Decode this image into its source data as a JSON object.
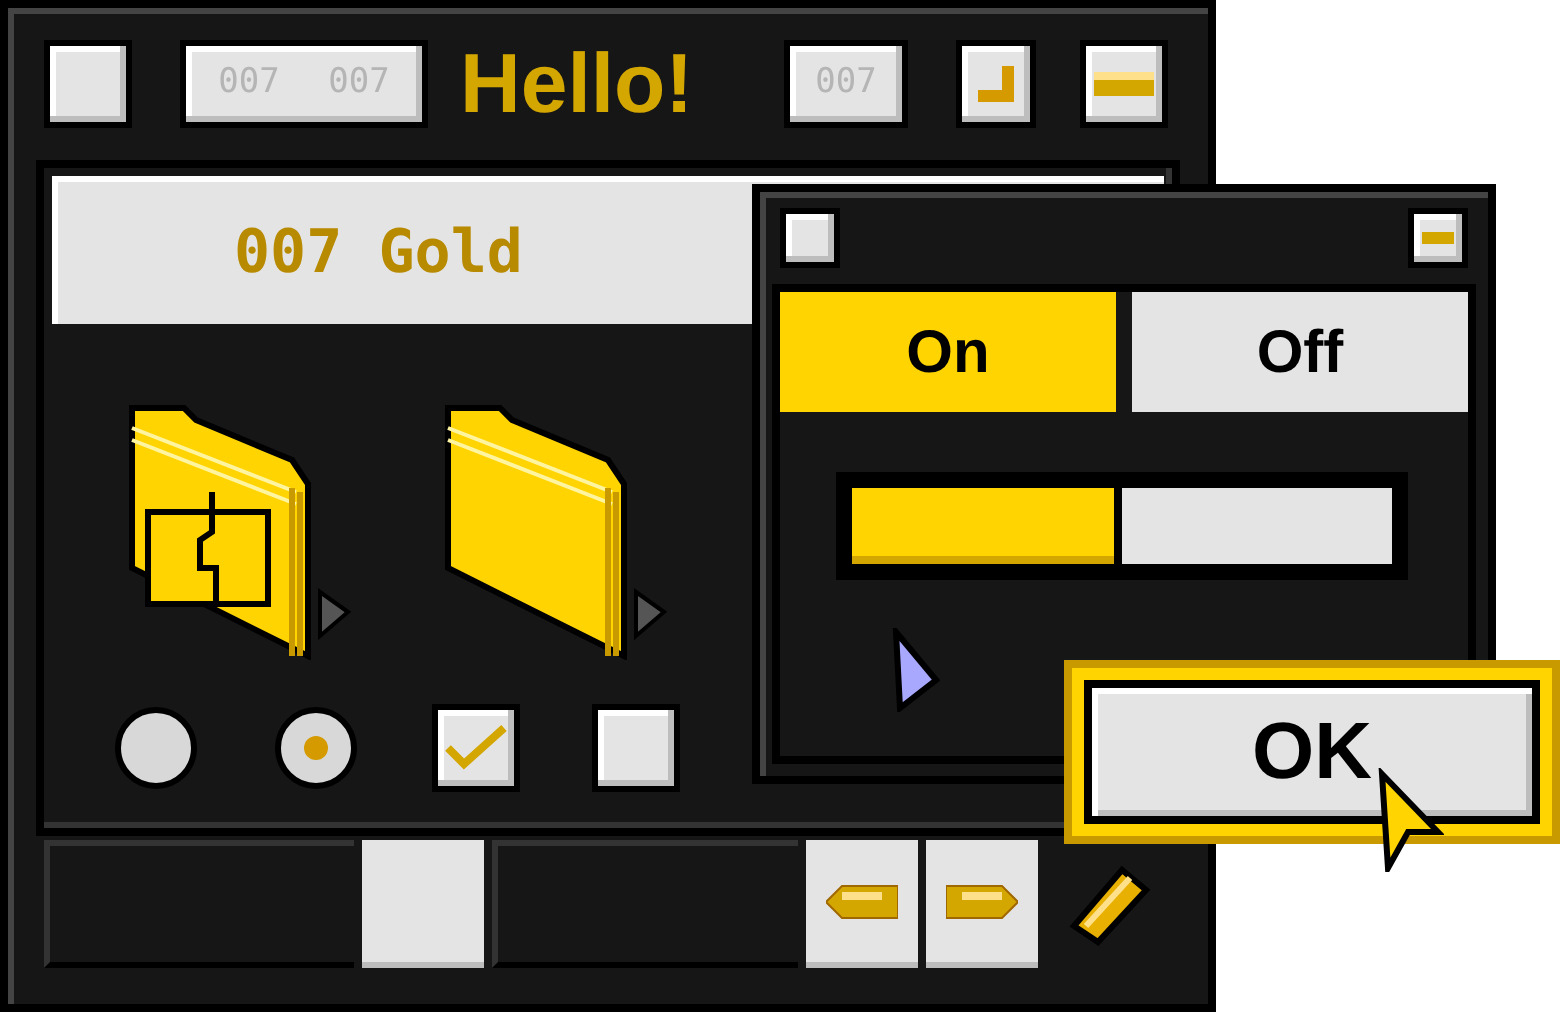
{
  "main_window": {
    "title": "Hello!",
    "title_left_labels": [
      "007",
      "007"
    ],
    "title_right_label": "007",
    "text_field": {
      "value": "007 Gold"
    },
    "radios": [
      {
        "selected": false
      },
      {
        "selected": true
      }
    ],
    "checkboxes": [
      {
        "checked": true
      },
      {
        "checked": false
      }
    ]
  },
  "dialog": {
    "tabs": [
      {
        "label": "On",
        "selected": true
      },
      {
        "label": "Off",
        "selected": false
      }
    ],
    "slider": {
      "level": 0.5
    },
    "ok_button": {
      "label": "OK"
    }
  }
}
